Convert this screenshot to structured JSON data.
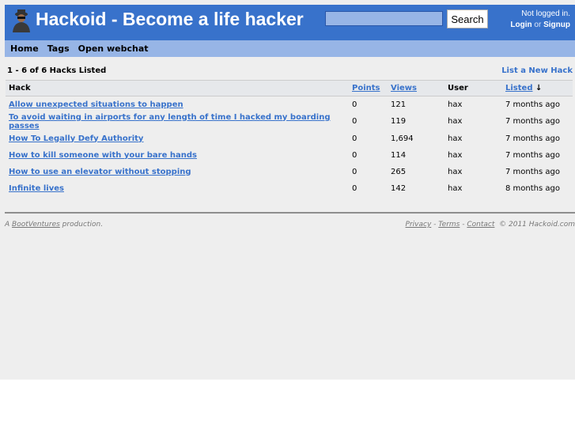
{
  "header": {
    "title": "Hackoid - Become a life hacker",
    "search_placeholder": "",
    "search_label": "Search",
    "login_status": "Not logged in.",
    "login": "Login",
    "or": "or",
    "signup": "Signup"
  },
  "nav": [
    "Home",
    "Tags",
    "Open webchat"
  ],
  "listing": {
    "count": "1 - 6 of 6 Hacks Listed",
    "new_hack": "List a New Hack",
    "columns": {
      "hack": "Hack",
      "points": "Points",
      "views": "Views",
      "user": "User",
      "listed": "Listed",
      "sort_arrow": "↓"
    },
    "rows": [
      {
        "hack": "Allow unexpected situations to happen",
        "points": "0",
        "views": "121",
        "user": "hax",
        "listed": "7 months ago"
      },
      {
        "hack": "To avoid waiting in airports for any length of time I hacked my boarding passes",
        "points": "0",
        "views": "119",
        "user": "hax",
        "listed": "7 months ago"
      },
      {
        "hack": "How To Legally Defy Authority",
        "points": "0",
        "views": "1,694",
        "user": "hax",
        "listed": "7 months ago"
      },
      {
        "hack": "How to kill someone with your bare hands",
        "points": "0",
        "views": "114",
        "user": "hax",
        "listed": "7 months ago"
      },
      {
        "hack": "How to use an elevator without stopping",
        "points": "0",
        "views": "265",
        "user": "hax",
        "listed": "7 months ago"
      },
      {
        "hack": "Infinite lives",
        "points": "0",
        "views": "142",
        "user": "hax",
        "listed": "8 months ago"
      }
    ]
  },
  "footer": {
    "prefix": "A",
    "company": "BootVentures",
    "suffix": "production.",
    "privacy": "Privacy",
    "terms": "Terms",
    "contact": "Contact",
    "sep": "-",
    "copyright": "© 2011 Hackoid.com"
  }
}
